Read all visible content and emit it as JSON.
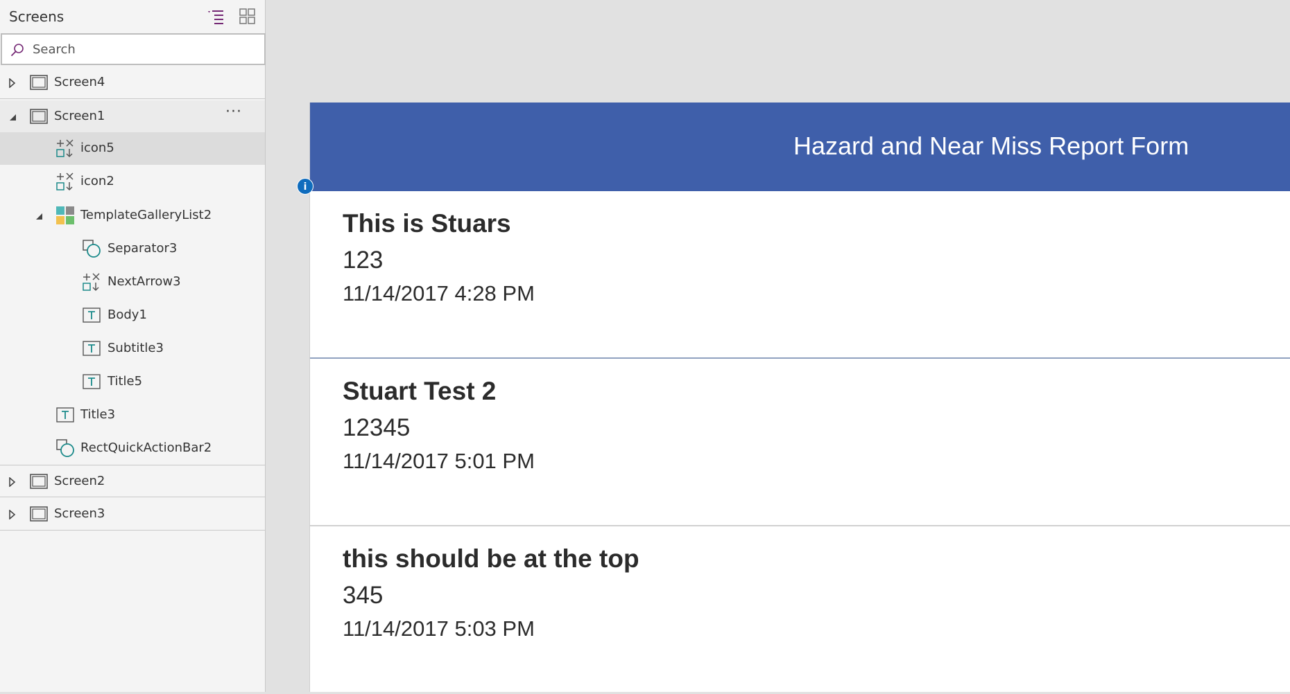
{
  "sidebar": {
    "title": "Screens",
    "search": {
      "placeholder": "Search",
      "value": ""
    },
    "tree": [
      {
        "label": "Screen4",
        "type": "screen",
        "caret": "collapsed"
      },
      {
        "label": "Screen1",
        "type": "screen",
        "caret": "expanded",
        "more": "···"
      },
      {
        "label": "icon5",
        "type": "icon",
        "selected": true
      },
      {
        "label": "icon2",
        "type": "icon"
      },
      {
        "label": "TemplateGalleryList2",
        "type": "gallery",
        "caret": "expanded"
      },
      {
        "label": "Separator3",
        "type": "shape"
      },
      {
        "label": "NextArrow3",
        "type": "icon"
      },
      {
        "label": "Body1",
        "type": "label"
      },
      {
        "label": "Subtitle3",
        "type": "label"
      },
      {
        "label": "Title5",
        "type": "label"
      },
      {
        "label": "Title3",
        "type": "label"
      },
      {
        "label": "RectQuickActionBar2",
        "type": "shape"
      },
      {
        "label": "Screen2",
        "type": "screen",
        "caret": "collapsed"
      },
      {
        "label": "Screen3",
        "type": "screen",
        "caret": "collapsed"
      }
    ]
  },
  "app": {
    "title": "Hazard and Near Miss Report Form",
    "info_badge": "i",
    "header_color": "#3f5faa",
    "gallery": [
      {
        "title": "This is Stuars",
        "subtitle": "123",
        "body": "11/14/2017 4:28 PM"
      },
      {
        "title": "Stuart Test 2",
        "subtitle": "12345",
        "body": "11/14/2017 5:01 PM"
      },
      {
        "title": "this should be at the top",
        "subtitle": "345",
        "body": "11/14/2017 5:03 PM"
      }
    ]
  }
}
